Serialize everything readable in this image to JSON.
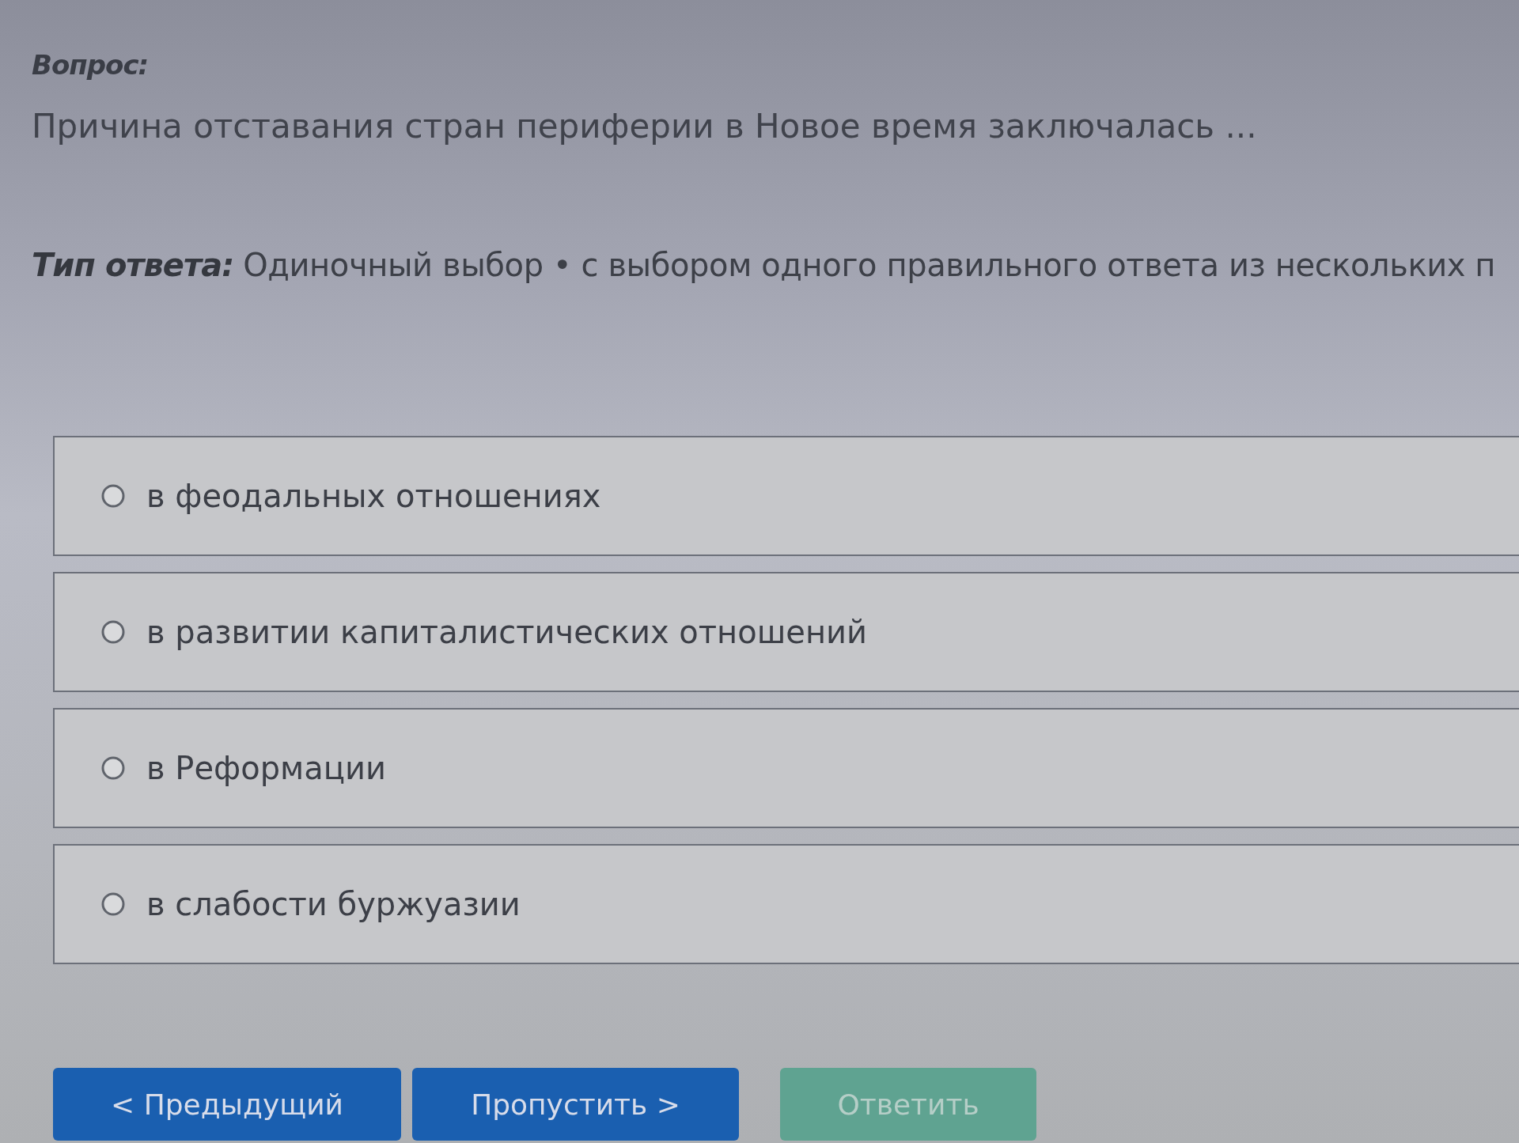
{
  "question": {
    "label": "Вопрос:",
    "text": "Причина отставания стран периферии в Новое время заключалась ..."
  },
  "answer_type": {
    "label": "Тип ответа:",
    "value": "Одиночный выбор • с выбором одного правильного ответа из нескольких п"
  },
  "options": [
    {
      "text": "в феодальных отношениях",
      "selected": false
    },
    {
      "text": "в развитии капиталистических отношений",
      "selected": false
    },
    {
      "text": "в Реформации",
      "selected": false
    },
    {
      "text": "в слабости буржуазии",
      "selected": false
    }
  ],
  "buttons": [
    {
      "label": "< Предыдущий",
      "kind": "primary",
      "disabled": false
    },
    {
      "label": "Пропустить >",
      "kind": "primary",
      "disabled": false
    },
    {
      "label": "Ответить",
      "kind": "submit",
      "disabled": true
    }
  ]
}
